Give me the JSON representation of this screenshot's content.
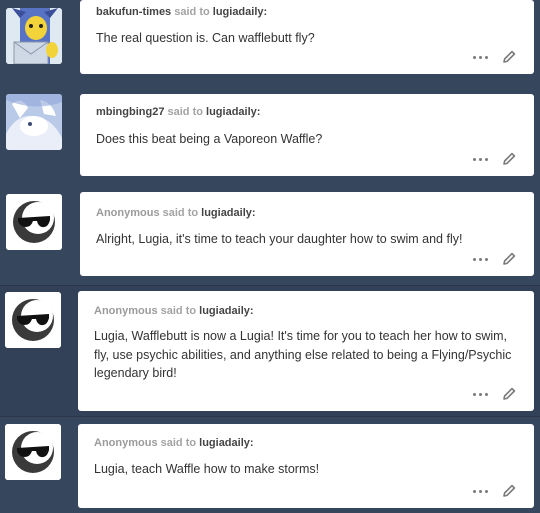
{
  "asks": [
    {
      "sender": "bakufun-times",
      "said_to": "said to",
      "recipient": "lugiadaily:",
      "message": "The real question is. Can wafflebutt fly?",
      "avatar_icon": "pikachu-avatar-icon"
    },
    {
      "sender": "mbingbing27",
      "said_to": "said to",
      "recipient": "lugiadaily:",
      "message": "Does this beat being a Vaporeon Waffle?",
      "avatar_icon": "white-creature-avatar-icon"
    },
    {
      "sender": "Anonymous",
      "said_to": "said to",
      "recipient": "lugiadaily:",
      "message": "Alright, Lugia, it's time to teach your daughter how to swim and fly!",
      "avatar_icon": "anonymous-sunglasses-icon"
    },
    {
      "sender": "Anonymous",
      "said_to": "said to",
      "recipient": "lugiadaily:",
      "message": "Lugia, Wafflebutt is now a Lugia! It's time for you to teach her how to swim, fly, use psychic abilities, and anything else related to being a Flying/Psychic legendary bird!",
      "avatar_icon": "anonymous-sunglasses-icon"
    },
    {
      "sender": "Anonymous",
      "said_to": "said to",
      "recipient": "lugiadaily:",
      "message": "Lugia, teach Waffle how to make storms!",
      "avatar_icon": "anonymous-sunglasses-icon"
    }
  ],
  "icons": {
    "more": "more-dots-icon",
    "edit": "pencil-icon"
  },
  "colors": {
    "background": "#36465d",
    "card": "#ffffff",
    "meta": "#9b9b9b"
  }
}
